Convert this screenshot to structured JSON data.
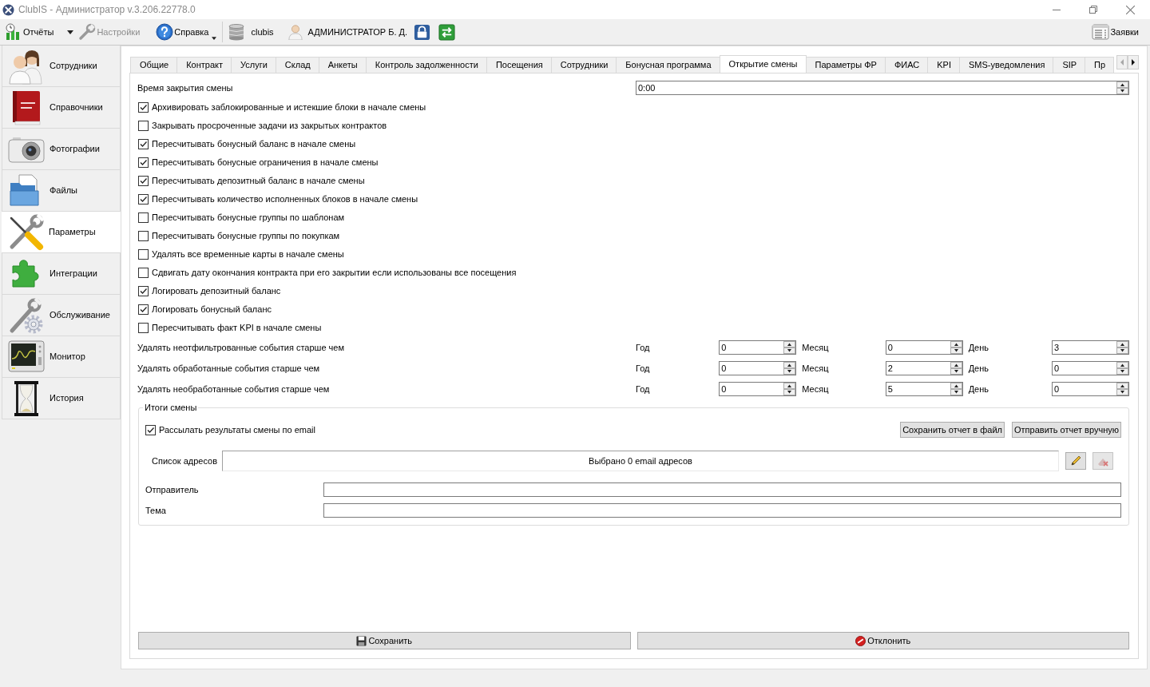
{
  "window": {
    "title": "ClubIS - Администратор v.3.206.22778.0"
  },
  "toolbar": {
    "buttons": [
      {
        "kind": "split",
        "label": "Отчёты",
        "disabled": false
      },
      {
        "kind": "plain",
        "label": "Настройки",
        "disabled": true
      },
      {
        "kind": "menu",
        "label": "Справка",
        "disabled": false
      }
    ],
    "database": "clubis",
    "user": "АДМИНИСТРАТОР Б. Д.",
    "requests": "Заявки"
  },
  "sidebar": {
    "items": [
      {
        "label": "Сотрудники",
        "selected": false
      },
      {
        "label": "Справочники",
        "selected": false
      },
      {
        "label": "Фотографии",
        "selected": false
      },
      {
        "label": "Файлы",
        "selected": false
      },
      {
        "label": "Параметры",
        "selected": true
      },
      {
        "label": "Интеграции",
        "selected": false
      },
      {
        "label": "Обслуживание",
        "selected": false
      },
      {
        "label": "Монитор",
        "selected": false
      },
      {
        "label": "История",
        "selected": false
      }
    ]
  },
  "tabs": {
    "items": [
      {
        "label": "Общие",
        "selected": false
      },
      {
        "label": "Контракт",
        "selected": false
      },
      {
        "label": "Услуги",
        "selected": false
      },
      {
        "label": "Склад",
        "selected": false
      },
      {
        "label": "Анкеты",
        "selected": false
      },
      {
        "label": "Контроль задолженности",
        "selected": false
      },
      {
        "label": "Посещения",
        "selected": false
      },
      {
        "label": "Сотрудники",
        "selected": false
      },
      {
        "label": "Бонусная программа",
        "selected": false
      },
      {
        "label": "Открытие смены",
        "selected": true
      },
      {
        "label": "Параметры ФР",
        "selected": false
      },
      {
        "label": "ФИАС",
        "selected": false
      },
      {
        "label": "KPI",
        "selected": false
      },
      {
        "label": "SMS-уведомления",
        "selected": false
      },
      {
        "label": "SIP",
        "selected": false
      },
      {
        "label": "Пр",
        "selected": false
      }
    ],
    "scroll": [
      {
        "kind": "left",
        "disabled": true
      },
      {
        "kind": "right",
        "disabled": false
      }
    ]
  },
  "close_time": {
    "label": "Время закрытия смены",
    "value": "0:00"
  },
  "options": [
    {
      "label": "Архивировать заблокированные и истекшие блоки в начале смены",
      "checked": true
    },
    {
      "label": "Закрывать просроченные задачи из закрытых контрактов",
      "checked": false
    },
    {
      "label": "Пересчитывать бонусный баланс в начале смены",
      "checked": true
    },
    {
      "label": "Пересчитывать бонусные ограничения в начале смены",
      "checked": true
    },
    {
      "label": "Пересчитывать депозитный баланс в начале смены",
      "checked": true
    },
    {
      "label": "Пересчитывать количество исполненных блоков в начале смены",
      "checked": true
    },
    {
      "label": "Пересчитывать бонусные группы по шаблонам",
      "checked": false
    },
    {
      "label": "Пересчитывать бонусные группы по покупкам",
      "checked": false
    },
    {
      "label": "Удалять все временные карты в начале смены",
      "checked": false
    },
    {
      "label": "Сдвигать дату окончания контракта при его закрытии если использованы все посещения",
      "checked": false
    },
    {
      "label": "Логировать депозитный баланс",
      "checked": true
    },
    {
      "label": "Логировать бонусный баланс",
      "checked": true
    },
    {
      "label": "Пересчитывать факт KPI в начале смены",
      "checked": false
    }
  ],
  "cleanup": [
    {
      "label": "Удалять неотфильтрованные события старше чем",
      "fields": [
        {
          "unit": "Год",
          "value": "0"
        },
        {
          "unit": "Месяц",
          "value": "0"
        },
        {
          "unit": "День",
          "value": "3"
        }
      ]
    },
    {
      "label": "Удалять обработанные события старше чем",
      "fields": [
        {
          "unit": "Год",
          "value": "0"
        },
        {
          "unit": "Месяц",
          "value": "2"
        },
        {
          "unit": "День",
          "value": "0"
        }
      ]
    },
    {
      "label": "Удалять необработанные события старше чем",
      "fields": [
        {
          "unit": "Год",
          "value": "0"
        },
        {
          "unit": "Месяц",
          "value": "5"
        },
        {
          "unit": "День",
          "value": "0"
        }
      ]
    }
  ],
  "shift_report": {
    "title": "Итоги смены",
    "send_email": {
      "label": "Рассылать результаты смены по email",
      "checked": true
    },
    "buttons": [
      "Сохранить отчет в файл",
      "Отправить отчет вручную"
    ],
    "addresses": {
      "label": "Список адресов",
      "summary": "Выбрано 0 email адресов",
      "tools": [
        {
          "kind": "edit",
          "disabled": false
        },
        {
          "kind": "clear",
          "disabled": true
        }
      ]
    },
    "fields": [
      {
        "label": "Отправитель"
      },
      {
        "label": "Тема"
      }
    ]
  },
  "actions": [
    {
      "kind": "save",
      "label": "Сохранить"
    },
    {
      "kind": "cancel",
      "label": "Отклонить"
    }
  ]
}
